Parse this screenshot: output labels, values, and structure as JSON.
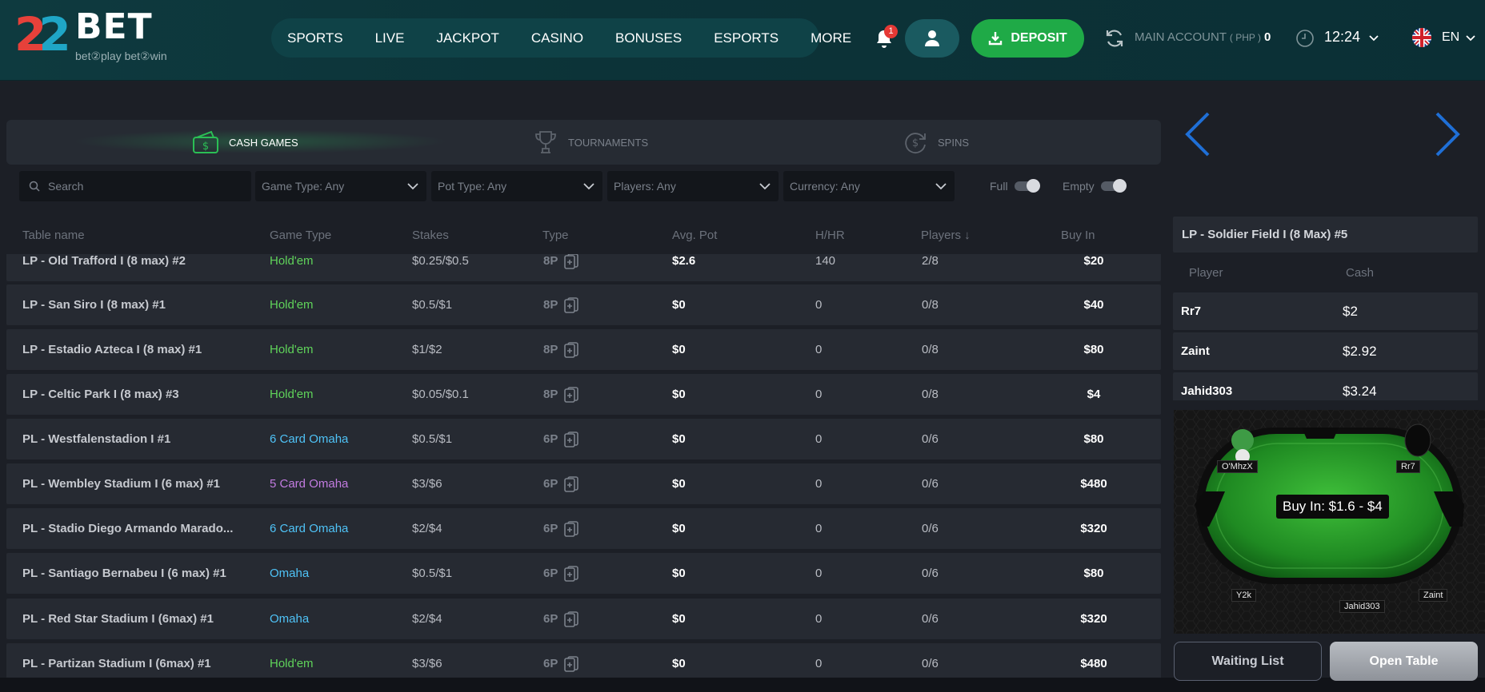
{
  "header": {
    "logo": {
      "digits": "22",
      "brand": "BET",
      "tagline": "bet②play  bet②win"
    },
    "nav": [
      "SPORTS",
      "LIVE",
      "JACKPOT",
      "CASINO",
      "BONUSES",
      "ESPORTS",
      "MORE"
    ],
    "notification_count": "1",
    "deposit_label": "DEPOSIT",
    "account": {
      "label": "MAIN ACCOUNT",
      "currency": "( PHP )",
      "balance": "0"
    },
    "time": "12:24",
    "language": "EN",
    "colors": {
      "header_bg": "#0c3338",
      "deposit": "#1faa47",
      "accent_blue": "#1f6fd6"
    }
  },
  "tabs": [
    {
      "label": "CASH GAMES",
      "icon": "cash-icon",
      "active": true
    },
    {
      "label": "TOURNAMENTS",
      "icon": "trophy-icon",
      "active": false
    },
    {
      "label": "SPINS",
      "icon": "spins-icon",
      "active": false
    }
  ],
  "filters": {
    "search_placeholder": "Search",
    "dropdowns": [
      "Game Type: Any",
      "Pot Type: Any",
      "Players: Any",
      "Currency: Any"
    ],
    "toggles": [
      "Full",
      "Empty"
    ]
  },
  "table": {
    "columns": [
      "Table name",
      "Game Type",
      "Stakes",
      "Type",
      "Avg. Pot",
      "H/HR",
      "Players ↓",
      "Buy In"
    ],
    "rows": [
      {
        "name": "LP - Old Trafford I (8 max) #2",
        "game": "Hold'em",
        "game_color": "#5fd35a",
        "stakes": "$0.25/$0.5",
        "type": "8P",
        "pot": "$2.6",
        "hhr": "140",
        "players": "2/8",
        "buyin": "$20"
      },
      {
        "name": "LP - San Siro I (8 max) #1",
        "game": "Hold'em",
        "game_color": "#5fd35a",
        "stakes": "$0.5/$1",
        "type": "8P",
        "pot": "$0",
        "hhr": "0",
        "players": "0/8",
        "buyin": "$40"
      },
      {
        "name": "LP - Estadio Azteca I (8 max) #1",
        "game": "Hold'em",
        "game_color": "#5fd35a",
        "stakes": "$1/$2",
        "type": "8P",
        "pot": "$0",
        "hhr": "0",
        "players": "0/8",
        "buyin": "$80"
      },
      {
        "name": "LP - Celtic Park I (8 max) #3",
        "game": "Hold'em",
        "game_color": "#5fd35a",
        "stakes": "$0.05/$0.1",
        "type": "8P",
        "pot": "$0",
        "hhr": "0",
        "players": "0/8",
        "buyin": "$4"
      },
      {
        "name": "PL - Westfalenstadion I #1",
        "game": "6 Card Omaha",
        "game_color": "#4fc3f7",
        "stakes": "$0.5/$1",
        "type": "6P",
        "pot": "$0",
        "hhr": "0",
        "players": "0/6",
        "buyin": "$80"
      },
      {
        "name": "PL - Wembley Stadium I (6 max) #1",
        "game": "5 Card Omaha",
        "game_color": "#c27be0",
        "stakes": "$3/$6",
        "type": "6P",
        "pot": "$0",
        "hhr": "0",
        "players": "0/6",
        "buyin": "$480"
      },
      {
        "name": "PL - Stadio Diego Armando Marado...",
        "game": "6 Card Omaha",
        "game_color": "#4fc3f7",
        "stakes": "$2/$4",
        "type": "6P",
        "pot": "$0",
        "hhr": "0",
        "players": "0/6",
        "buyin": "$320"
      },
      {
        "name": "PL - Santiago Bernabeu I (6 max) #1",
        "game": "Omaha",
        "game_color": "#4fc3f7",
        "stakes": "$0.5/$1",
        "type": "6P",
        "pot": "$0",
        "hhr": "0",
        "players": "0/6",
        "buyin": "$80"
      },
      {
        "name": "PL - Red Star Stadium I (6max) #1",
        "game": "Omaha",
        "game_color": "#4fc3f7",
        "stakes": "$2/$4",
        "type": "6P",
        "pot": "$0",
        "hhr": "0",
        "players": "0/6",
        "buyin": "$320"
      },
      {
        "name": "PL - Partizan Stadium I (6max) #1",
        "game": "Hold'em",
        "game_color": "#5fd35a",
        "stakes": "$3/$6",
        "type": "6P",
        "pot": "$0",
        "hhr": "0",
        "players": "0/6",
        "buyin": "$480"
      }
    ]
  },
  "detail": {
    "title": "LP - Soldier Field I (8 Max) #5",
    "columns": [
      "Player",
      "Cash"
    ],
    "players": [
      {
        "name": "Rr7",
        "cash": "$2"
      },
      {
        "name": "Zaint",
        "cash": "$2.92"
      },
      {
        "name": "Jahid303",
        "cash": "$3.24"
      }
    ],
    "preview": {
      "buyin": "Buy In: $1.6 - $4",
      "seats": [
        "O'MhzX",
        "Rr7",
        "Y2k",
        "Jahid303",
        "Zaint"
      ]
    },
    "waiting_list_label": "Waiting List",
    "open_table_label": "Open Table"
  }
}
